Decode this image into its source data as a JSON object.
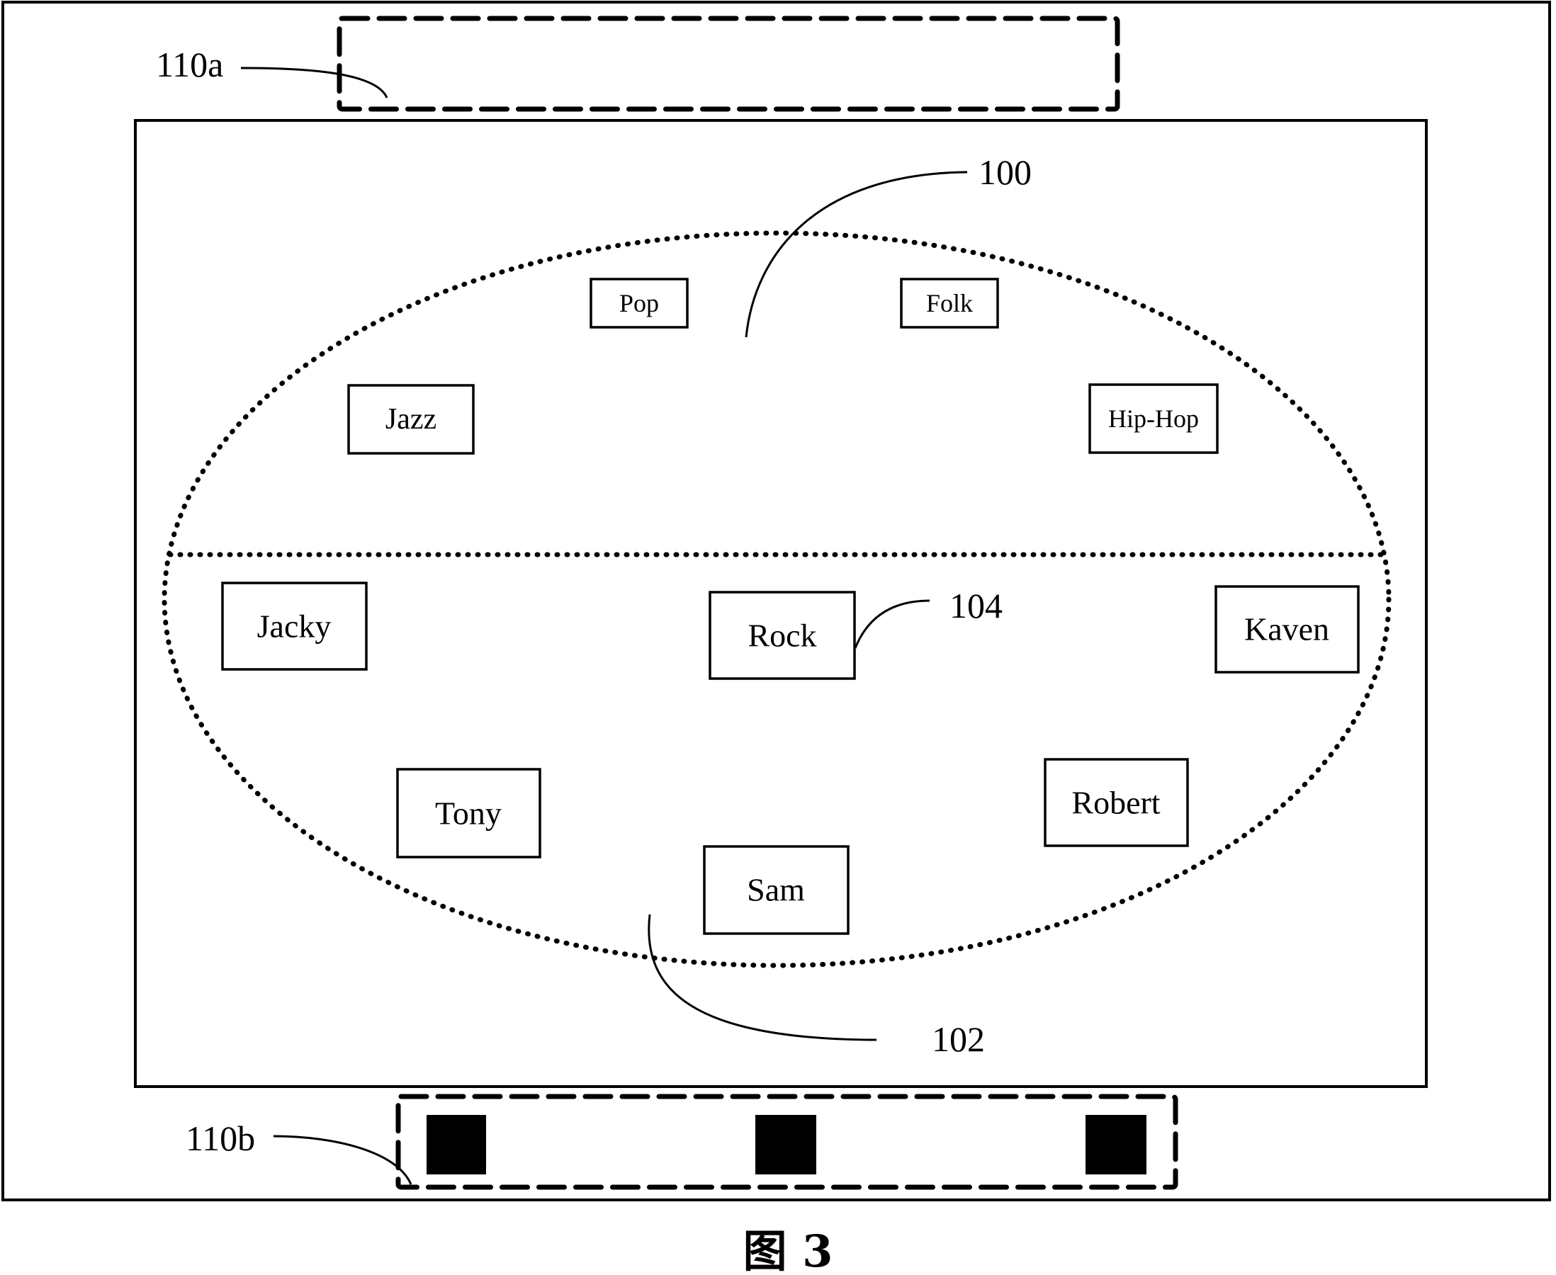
{
  "figure": {
    "caption": "图 3",
    "references": {
      "top_bar": "110a",
      "bottom_bar": "110b",
      "ellipse_region": "100",
      "lower_region": "102",
      "item": "104"
    },
    "upper_region_items": [
      {
        "label": "Pop"
      },
      {
        "label": "Folk"
      },
      {
        "label": "Jazz"
      },
      {
        "label": "Hip-Hop"
      }
    ],
    "lower_region_items": [
      {
        "label": "Jacky"
      },
      {
        "label": "Rock"
      },
      {
        "label": "Kaven"
      },
      {
        "label": "Tony"
      },
      {
        "label": "Robert"
      },
      {
        "label": "Sam"
      }
    ],
    "bottom_bar_buttons": [
      {
        "icon": "black-square"
      },
      {
        "icon": "black-square"
      },
      {
        "icon": "black-square"
      }
    ]
  }
}
